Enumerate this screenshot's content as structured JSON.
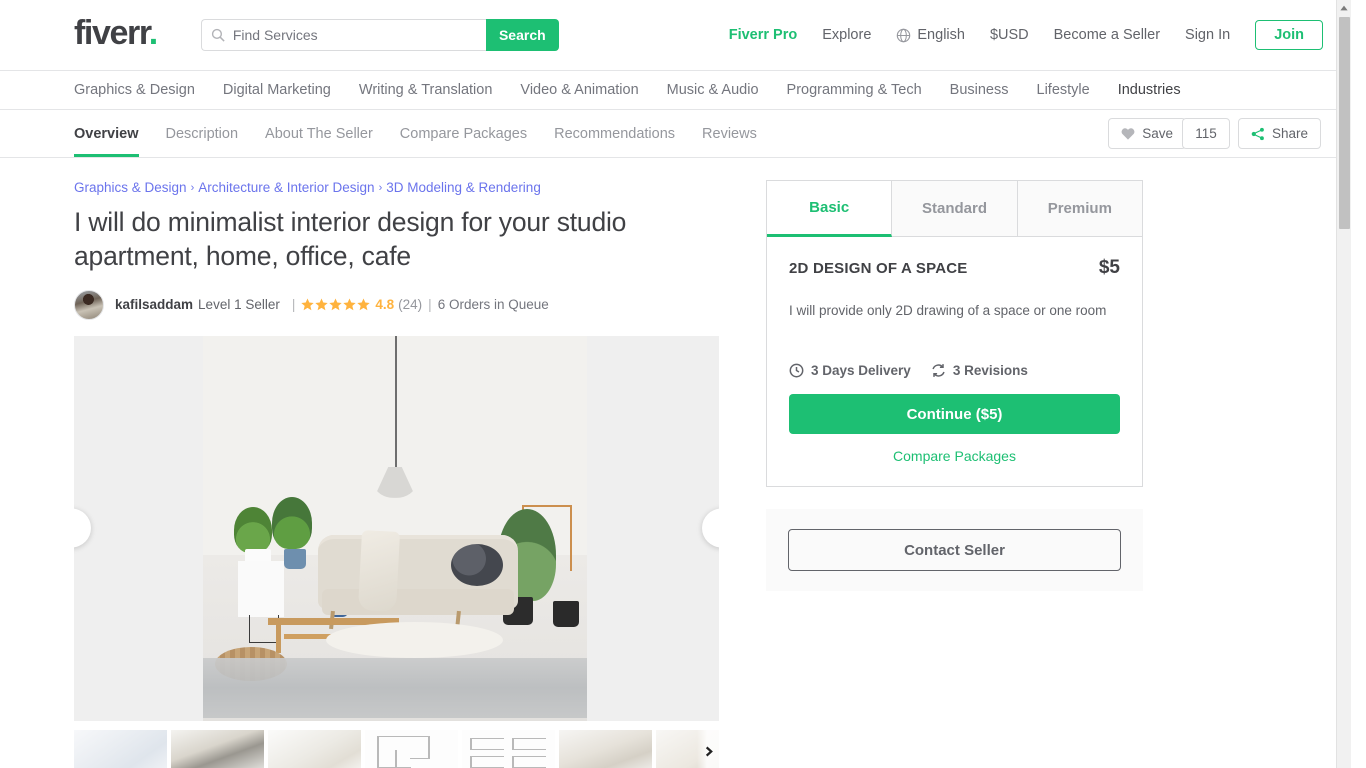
{
  "header": {
    "logo_text": "fiverr",
    "logo_dot": ".",
    "search_placeholder": "Find Services",
    "search_value": "",
    "search_button": "Search",
    "nav": [
      {
        "label": "Fiverr Pro",
        "accent": true
      },
      {
        "label": "Explore",
        "accent": false
      },
      {
        "label": "English",
        "accent": false,
        "icon": "globe-icon"
      },
      {
        "label": "$USD",
        "accent": false
      },
      {
        "label": "Become a Seller",
        "accent": false
      },
      {
        "label": "Sign In",
        "accent": false
      }
    ],
    "join_label": "Join"
  },
  "category_nav": {
    "items": [
      {
        "label": "Graphics & Design",
        "dark": false
      },
      {
        "label": "Digital Marketing",
        "dark": false
      },
      {
        "label": "Writing & Translation",
        "dark": false
      },
      {
        "label": "Video & Animation",
        "dark": false
      },
      {
        "label": "Music & Audio",
        "dark": false
      },
      {
        "label": "Programming & Tech",
        "dark": false
      },
      {
        "label": "Business",
        "dark": false
      },
      {
        "label": "Lifestyle",
        "dark": false
      },
      {
        "label": "Industries",
        "dark": true
      }
    ]
  },
  "gig_tabs": {
    "items": [
      {
        "label": "Overview",
        "active": true
      },
      {
        "label": "Description",
        "active": false
      },
      {
        "label": "About The Seller",
        "active": false
      },
      {
        "label": "Compare Packages",
        "active": false
      },
      {
        "label": "Recommendations",
        "active": false
      },
      {
        "label": "Reviews",
        "active": false
      }
    ],
    "save_label": "Save",
    "save_count": "115",
    "share_label": "Share"
  },
  "gig": {
    "breadcrumb": [
      "Graphics & Design",
      "Architecture & Interior Design",
      "3D Modeling & Rendering"
    ],
    "breadcrumb_separator": "›",
    "title": "I will do minimalist interior design for your studio apartment, home, office, cafe",
    "seller": {
      "name": "kafilsaddam",
      "level": "Level 1 Seller",
      "rating": "4.8",
      "reviews_count": "(24)",
      "stars_filled": 5,
      "queue": "6 Orders in Queue",
      "separator": "|"
    },
    "gallery": {
      "prev_label": "Previous image",
      "next_label": "Next image",
      "thumbs_next_label": "More thumbnails",
      "thumbnails": [
        "interior-thumb-1",
        "interior-thumb-2",
        "interior-thumb-3",
        "floorplan-thumb-4",
        "floorplan-thumb-5",
        "interior-thumb-6",
        "interior-thumb-7"
      ]
    }
  },
  "package": {
    "tabs": [
      {
        "label": "Basic",
        "active": true
      },
      {
        "label": "Standard",
        "active": false
      },
      {
        "label": "Premium",
        "active": false
      }
    ],
    "name": "2D DESIGN OF A SPACE",
    "price": "$5",
    "description": "I will provide only 2D drawing of a space or one room",
    "delivery": "3 Days Delivery",
    "revisions": "3 Revisions",
    "continue_label": "Continue ($5)",
    "compare_label": "Compare Packages",
    "contact_label": "Contact Seller"
  },
  "colors": {
    "brand_green": "#1dbf73",
    "link_blue": "#6b74ec",
    "star_gold": "#ffb33e",
    "text_dark": "#404145",
    "text_gray": "#74767e"
  }
}
